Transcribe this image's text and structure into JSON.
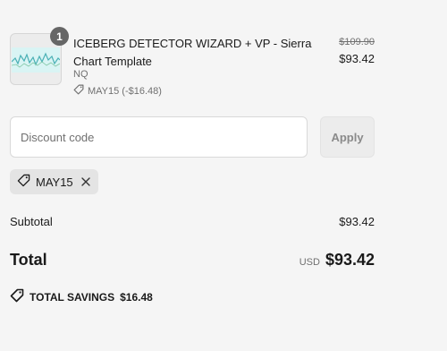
{
  "line_item": {
    "quantity": "1",
    "title": "ICEBERG DETECTOR WIZARD + VP - Sierra Chart Template",
    "variant": "NQ",
    "discount_label": "MAY15 (-$16.48)",
    "compare_price": "$109.90",
    "price": "$93.42",
    "thumbnail_icon": "chart-thumbnail"
  },
  "discount": {
    "placeholder": "Discount code",
    "apply_label": "Apply",
    "applied_code": "MAY15"
  },
  "summary": {
    "subtotal_label": "Subtotal",
    "subtotal_value": "$93.42",
    "total_label": "Total",
    "currency": "USD",
    "total_value": "$93.42",
    "savings_label": "TOTAL SAVINGS",
    "savings_value": "$16.48"
  },
  "colors": {
    "background": "#f5f5f5",
    "badge": "#666666",
    "chip": "#e4e4e4",
    "muted_text": "#707070"
  }
}
